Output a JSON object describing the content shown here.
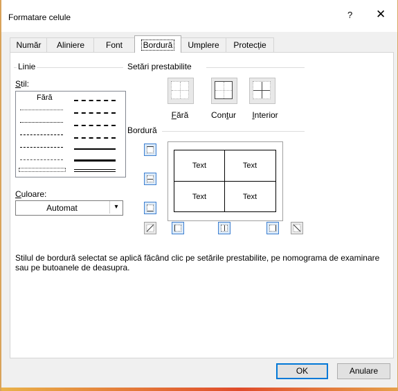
{
  "window": {
    "title": "Formatare celule",
    "help_glyph": "?",
    "close_glyph": "✕"
  },
  "tabs": [
    {
      "label": "Număr"
    },
    {
      "label": "Aliniere"
    },
    {
      "label": "Font"
    },
    {
      "label": "Bordură",
      "active": true
    },
    {
      "label": "Umplere"
    },
    {
      "label": "Protecție"
    }
  ],
  "line_group": {
    "label": "Linie",
    "style_label_u": "S",
    "style_label_rest": "til:",
    "none_label": "Fără",
    "color_label_u": "C",
    "color_label_rest": "uloare:",
    "color_value": "Automat"
  },
  "presets": {
    "label": "Setări prestabilite",
    "items": [
      {
        "label_u": "F",
        "label_rest": "ără"
      },
      {
        "label_pre": "Con",
        "label_u": "t",
        "label_rest": "ur"
      },
      {
        "label_u": "I",
        "label_rest": "nterior"
      }
    ]
  },
  "border_group": {
    "label": "Bordură",
    "preview_cells": [
      "Text",
      "Text",
      "Text",
      "Text"
    ]
  },
  "info_text": "Stilul de bordură selectat se aplică făcând clic pe setările prestabilite, pe nomograma de examinare sau pe butoanele de deasupra.",
  "buttons": {
    "ok": "OK",
    "cancel": "Anulare"
  },
  "colors": {
    "accent": "#0078d7",
    "toggle_border": "#3c7fd1",
    "toggle_fill": "#dbe9f7",
    "frame_orange": "#e9b24a"
  },
  "icons": {
    "help": "help-icon",
    "close": "close-icon",
    "dropdown": "chevron-down-icon",
    "top_border": "border-top-icon",
    "middle_h_border": "border-inside-horizontal-icon",
    "bottom_border": "border-bottom-icon",
    "diag_up": "diagonal-up-icon",
    "left_border": "border-left-icon",
    "middle_v_border": "border-inside-vertical-icon",
    "right_border": "border-right-icon",
    "diag_down": "diagonal-down-icon"
  }
}
